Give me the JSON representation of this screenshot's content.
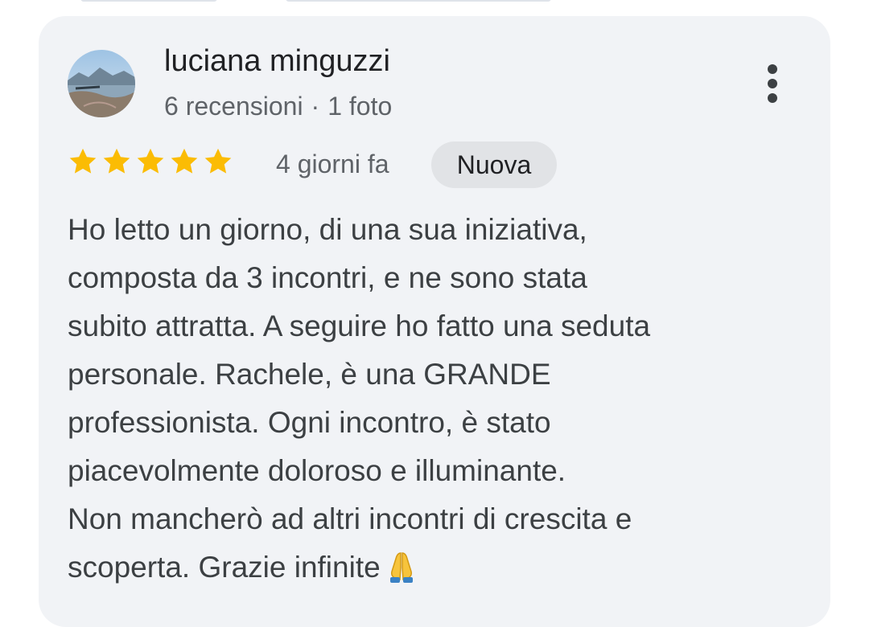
{
  "review": {
    "author": {
      "name": "luciana minguzzi",
      "review_count": "6 recensioni",
      "separator": "·",
      "photo_count": "1 foto",
      "avatar": "landscape-photo-avatar"
    },
    "rating": {
      "value": 5,
      "max": 5,
      "star_color": "#fbbc04",
      "icon": "star-icon"
    },
    "date": "4 giorni fa",
    "badge": "Nuova",
    "more_icon": "more-vert-icon",
    "text_lines": [
      "Ho letto un giorno, di una sua iniziativa,",
      "composta da 3 incontri, e ne sono stata",
      "subito attratta. A seguire ho fatto una seduta",
      "personale. Rachele, è una GRANDE",
      "professionista. Ogni incontro, è stato",
      "piacevolmente doloroso e illuminante.",
      "Non mancherò ad altri incontri di crescita e",
      "scoperta. Grazie infinite"
    ],
    "end_emoji_icon": "folded-hands-icon"
  },
  "colors": {
    "card_background": "#f1f3f6",
    "badge_background": "#e1e3e6",
    "primary_text": "#202124",
    "secondary_text": "#5f6368"
  }
}
